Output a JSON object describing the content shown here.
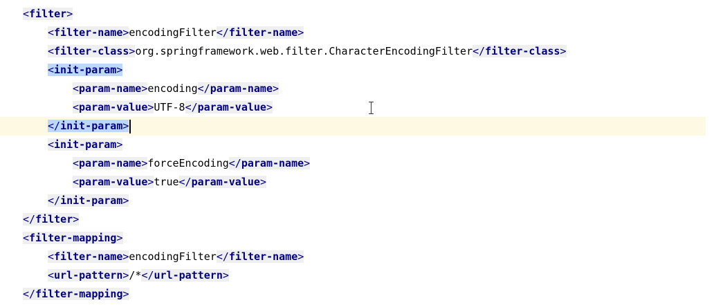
{
  "lines": [
    {
      "indent": 0,
      "parts": [
        {
          "t": "open",
          "name": "filter"
        }
      ]
    },
    {
      "indent": 1,
      "parts": [
        {
          "t": "open",
          "name": "filter-name"
        },
        {
          "t": "text",
          "v": "encodingFilter"
        },
        {
          "t": "close",
          "name": "filter-name"
        }
      ]
    },
    {
      "indent": 1,
      "parts": [
        {
          "t": "open",
          "name": "filter-class"
        },
        {
          "t": "text",
          "v": "org.springframework.web.filter.CharacterEncodingFilter"
        },
        {
          "t": "close",
          "name": "filter-class"
        }
      ]
    },
    {
      "indent": 1,
      "parts": [
        {
          "t": "open",
          "name": "init-param",
          "hl": true
        }
      ]
    },
    {
      "indent": 2,
      "parts": [
        {
          "t": "open",
          "name": "param-name"
        },
        {
          "t": "text",
          "v": "encoding"
        },
        {
          "t": "close",
          "name": "param-name"
        }
      ]
    },
    {
      "indent": 2,
      "parts": [
        {
          "t": "open",
          "name": "param-value"
        },
        {
          "t": "text",
          "v": "UTF-8"
        },
        {
          "t": "close",
          "name": "param-value"
        }
      ]
    },
    {
      "indent": 1,
      "current": true,
      "parts": [
        {
          "t": "close",
          "name": "init-param",
          "hl": true,
          "caret": true
        }
      ]
    },
    {
      "indent": 1,
      "parts": [
        {
          "t": "open",
          "name": "init-param"
        }
      ]
    },
    {
      "indent": 2,
      "parts": [
        {
          "t": "open",
          "name": "param-name"
        },
        {
          "t": "text",
          "v": "forceEncoding"
        },
        {
          "t": "close",
          "name": "param-name"
        }
      ]
    },
    {
      "indent": 2,
      "parts": [
        {
          "t": "open",
          "name": "param-value"
        },
        {
          "t": "text",
          "v": "true"
        },
        {
          "t": "close",
          "name": "param-value"
        }
      ]
    },
    {
      "indent": 1,
      "parts": [
        {
          "t": "close",
          "name": "init-param"
        }
      ]
    },
    {
      "indent": 0,
      "parts": [
        {
          "t": "close",
          "name": "filter"
        }
      ]
    },
    {
      "indent": 0,
      "parts": [
        {
          "t": "open",
          "name": "filter-mapping"
        }
      ]
    },
    {
      "indent": 1,
      "parts": [
        {
          "t": "open",
          "name": "filter-name"
        },
        {
          "t": "text",
          "v": "encodingFilter"
        },
        {
          "t": "close",
          "name": "filter-name"
        }
      ]
    },
    {
      "indent": 1,
      "parts": [
        {
          "t": "open",
          "name": "url-pattern"
        },
        {
          "t": "text",
          "v": "/*"
        },
        {
          "t": "close",
          "name": "url-pattern"
        }
      ]
    },
    {
      "indent": 0,
      "parts": [
        {
          "t": "close",
          "name": "filter-mapping"
        }
      ]
    }
  ]
}
